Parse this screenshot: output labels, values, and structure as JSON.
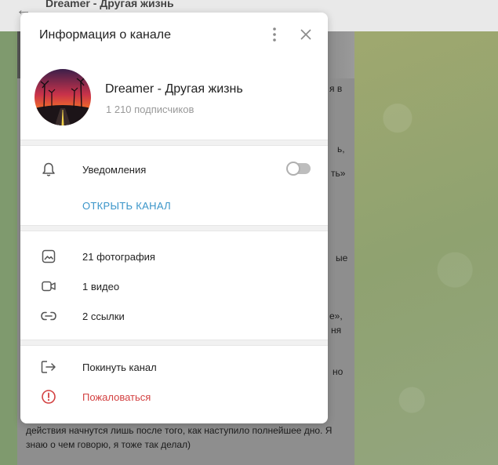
{
  "background": {
    "window_title": "Dreamer - Другая жизнь",
    "message_fragments": [
      "я в",
      "ь,",
      "ть»",
      "ые",
      "е»,",
      "ня",
      "но"
    ],
    "message_bottom": "действия начнутся лишь после того, как наступило полнейшее дно. Я знаю о чем говорю, я тоже так делал)"
  },
  "modal": {
    "title": "Информация о канале",
    "more_icon": "more-vertical-icon",
    "close_icon": "close-icon",
    "channel": {
      "name": "Dreamer - Другая жизнь",
      "subscribers": "1 210 подписчиков"
    },
    "notifications": {
      "label": "Уведомления",
      "enabled": false
    },
    "open_channel_label": "ОТКРЫТЬ КАНАЛ",
    "media": [
      {
        "icon": "photo-icon",
        "label": "21 фотография"
      },
      {
        "icon": "video-icon",
        "label": "1 видео"
      },
      {
        "icon": "link-icon",
        "label": "2 ссылки"
      }
    ],
    "actions": {
      "leave_label": "Покинуть канал",
      "report_label": "Пожаловаться"
    }
  },
  "colors": {
    "accent": "#3a95c9",
    "danger": "#d34141",
    "muted": "#999999"
  }
}
